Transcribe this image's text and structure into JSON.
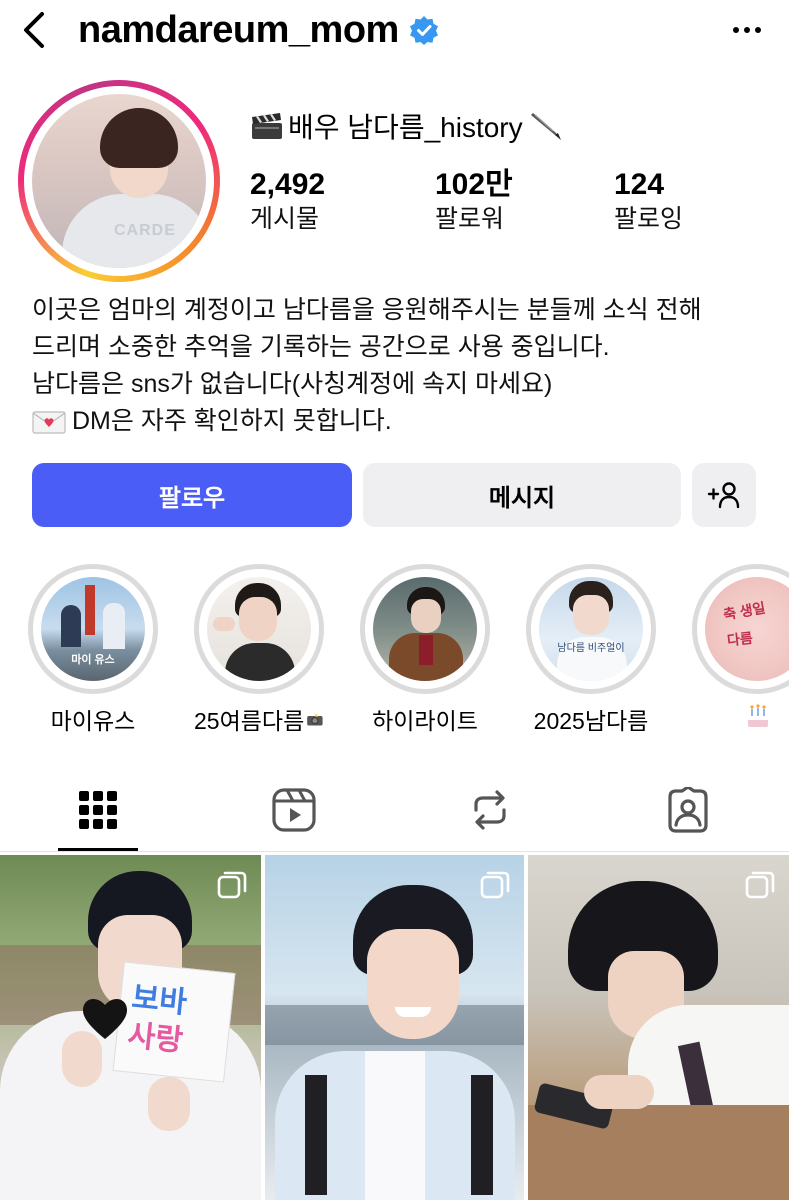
{
  "header": {
    "username": "namdareum_mom",
    "verified": true
  },
  "profile": {
    "display_name": "배우 남다름_history",
    "stats": {
      "posts": {
        "value": "2,492",
        "label": "게시물"
      },
      "followers": {
        "value": "102만",
        "label": "팔로워"
      },
      "following": {
        "value": "124",
        "label": "팔로잉"
      }
    },
    "bio": [
      "이곳은 엄마의 계정이고 남다름을 응원해주시는 분들께 소식 전해",
      "드리며 소중한 추억을 기록하는 공간으로 사용 중입니다.",
      "남다름은 sns가 없습니다(사칭계정에 속지 마세요)",
      "DM은 자주 확인하지 못합니다."
    ]
  },
  "buttons": {
    "follow": "팔로우",
    "message": "메시지"
  },
  "highlights": [
    {
      "label": "마이유스",
      "thumb_text": "마이 유스"
    },
    {
      "label": "25여름다름"
    },
    {
      "label": "하이라이트"
    },
    {
      "label": "2025남다름",
      "thumb_text": "남다름 비주얼이"
    },
    {
      "label": ""
    }
  ],
  "tabs": [
    "posts-grid",
    "reels",
    "reposts",
    "tagged"
  ],
  "colors": {
    "follow_button": "#4a5df6",
    "secondary_button": "#efeff1",
    "verified_badge": "#3897f0"
  }
}
